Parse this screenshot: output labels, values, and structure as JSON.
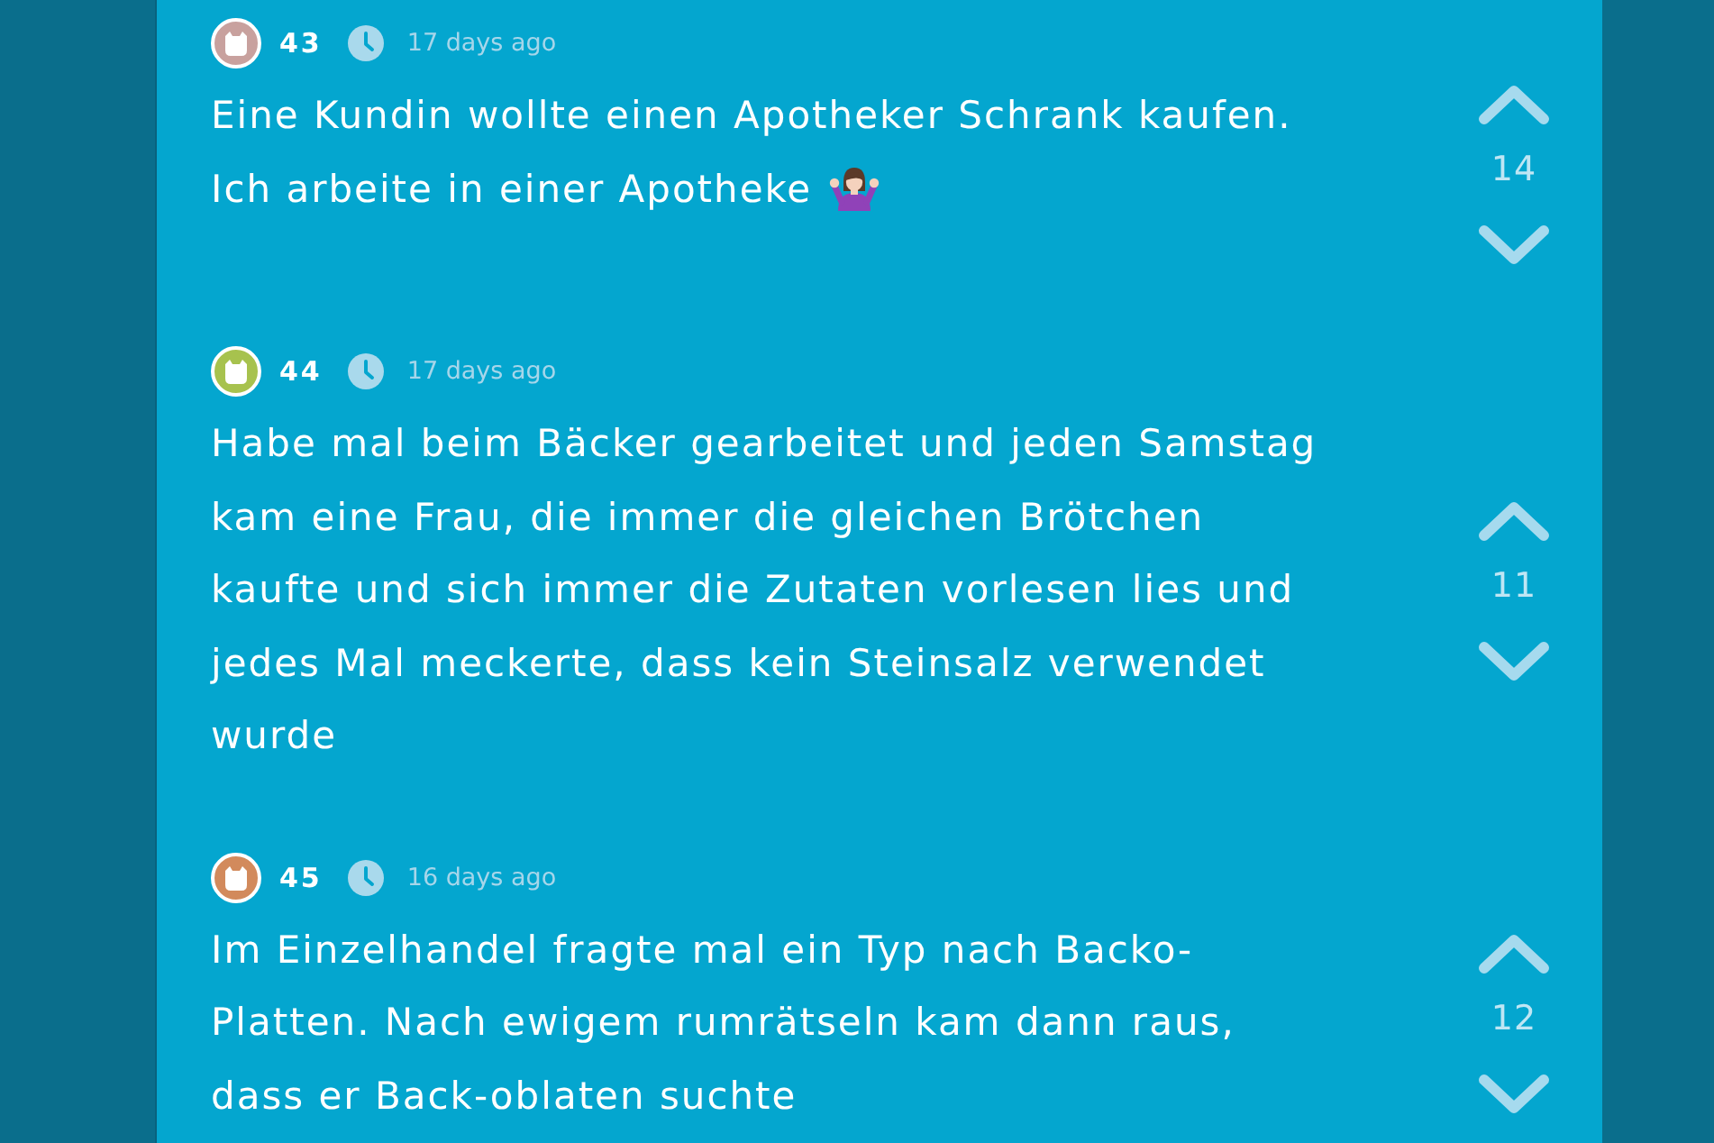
{
  "posts": [
    {
      "color": "#c8a19e",
      "author_number": "43",
      "time": "17 days ago",
      "text": "Eine Kundin wollte einen Apotheker Schrank kaufen. Ich arbeite in einer Apotheke",
      "shrug_emoji": true,
      "votes": "14"
    },
    {
      "color": "#a7c24e",
      "author_number": "44",
      "time": "17 days ago",
      "text": "Habe mal beim Bäcker gearbeitet und jeden Samstag kam eine Frau, die immer die gleichen Brötchen kaufte und sich immer die Zutaten vorlesen lies und jedes Mal meckerte, dass kein Steinsalz verwendet wurde",
      "votes": "11"
    },
    {
      "color": "#d28a5c",
      "author_number": "45",
      "time": "16 days ago",
      "text": "Im Einzelhandel fragte mal ein Typ nach Backo-Platten. Nach ewigem rumrätseln kam dann raus, dass er Back-oblaten suchte",
      "votes": "12"
    }
  ]
}
